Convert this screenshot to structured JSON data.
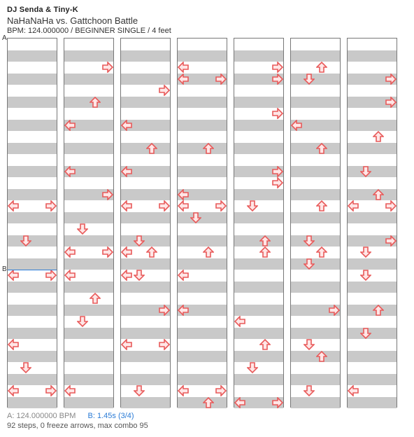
{
  "header": {
    "artist": "DJ Senda & Tiny-K",
    "title": "NaHaNaHa vs. Gattchoon Battle",
    "meta": "BPM: 124.000000 / BEGINNER SINGLE / 4 feet"
  },
  "legend": {
    "a": "A: 124.000000 BPM",
    "b": "B: 1.45s (3/4)"
  },
  "summary": "92 steps, 0 freeze arrows, max combo 95",
  "markers": [
    {
      "label": "A",
      "col": 0,
      "row": 0,
      "blue": false
    },
    {
      "label": "B",
      "col": 0,
      "row": 20,
      "blue": true
    }
  ],
  "chart_data": {
    "type": "table",
    "title": "Step chart — DDR single (4 lanes: L, D, U, R), 7 columns × 32 rows",
    "rows_per_column": 32,
    "lane_width": 18,
    "columns": [
      {
        "arrows": [
          {
            "row": 14,
            "lane": "L"
          },
          {
            "row": 14,
            "lane": "R"
          },
          {
            "row": 17,
            "lane": "D"
          },
          {
            "row": 20,
            "lane": "L"
          },
          {
            "row": 20,
            "lane": "R"
          },
          {
            "row": 26,
            "lane": "L"
          },
          {
            "row": 28,
            "lane": "D"
          },
          {
            "row": 30,
            "lane": "L"
          },
          {
            "row": 30,
            "lane": "R"
          }
        ]
      },
      {
        "arrows": [
          {
            "row": 2,
            "lane": "R"
          },
          {
            "row": 5,
            "lane": "U"
          },
          {
            "row": 7,
            "lane": "L"
          },
          {
            "row": 11,
            "lane": "L"
          },
          {
            "row": 13,
            "lane": "R"
          },
          {
            "row": 16,
            "lane": "D"
          },
          {
            "row": 18,
            "lane": "L"
          },
          {
            "row": 18,
            "lane": "R"
          },
          {
            "row": 20,
            "lane": "L"
          },
          {
            "row": 22,
            "lane": "U"
          },
          {
            "row": 24,
            "lane": "D"
          },
          {
            "row": 30,
            "lane": "L"
          }
        ]
      },
      {
        "arrows": [
          {
            "row": 4,
            "lane": "R"
          },
          {
            "row": 7,
            "lane": "L"
          },
          {
            "row": 9,
            "lane": "U"
          },
          {
            "row": 11,
            "lane": "L"
          },
          {
            "row": 14,
            "lane": "L"
          },
          {
            "row": 14,
            "lane": "R"
          },
          {
            "row": 17,
            "lane": "D"
          },
          {
            "row": 18,
            "lane": "L"
          },
          {
            "row": 18,
            "lane": "U"
          },
          {
            "row": 20,
            "lane": "L"
          },
          {
            "row": 20,
            "lane": "D"
          },
          {
            "row": 23,
            "lane": "R"
          },
          {
            "row": 26,
            "lane": "L"
          },
          {
            "row": 26,
            "lane": "R"
          },
          {
            "row": 30,
            "lane": "D"
          }
        ]
      },
      {
        "arrows": [
          {
            "row": 2,
            "lane": "L"
          },
          {
            "row": 3,
            "lane": "L"
          },
          {
            "row": 3,
            "lane": "R"
          },
          {
            "row": 9,
            "lane": "U"
          },
          {
            "row": 13,
            "lane": "L"
          },
          {
            "row": 14,
            "lane": "L"
          },
          {
            "row": 14,
            "lane": "R"
          },
          {
            "row": 15,
            "lane": "D"
          },
          {
            "row": 18,
            "lane": "U"
          },
          {
            "row": 20,
            "lane": "L"
          },
          {
            "row": 23,
            "lane": "L"
          },
          {
            "row": 30,
            "lane": "L"
          },
          {
            "row": 30,
            "lane": "R"
          },
          {
            "row": 31,
            "lane": "U"
          }
        ]
      },
      {
        "arrows": [
          {
            "row": 2,
            "lane": "R"
          },
          {
            "row": 3,
            "lane": "R"
          },
          {
            "row": 6,
            "lane": "R"
          },
          {
            "row": 11,
            "lane": "R"
          },
          {
            "row": 12,
            "lane": "R"
          },
          {
            "row": 14,
            "lane": "D"
          },
          {
            "row": 17,
            "lane": "U"
          },
          {
            "row": 18,
            "lane": "U"
          },
          {
            "row": 24,
            "lane": "L"
          },
          {
            "row": 26,
            "lane": "U"
          },
          {
            "row": 28,
            "lane": "D"
          },
          {
            "row": 31,
            "lane": "L"
          },
          {
            "row": 31,
            "lane": "R"
          }
        ]
      },
      {
        "arrows": [
          {
            "row": 2,
            "lane": "U"
          },
          {
            "row": 3,
            "lane": "D"
          },
          {
            "row": 7,
            "lane": "L"
          },
          {
            "row": 9,
            "lane": "U"
          },
          {
            "row": 14,
            "lane": "U"
          },
          {
            "row": 17,
            "lane": "D"
          },
          {
            "row": 18,
            "lane": "U"
          },
          {
            "row": 19,
            "lane": "D"
          },
          {
            "row": 23,
            "lane": "R"
          },
          {
            "row": 26,
            "lane": "D"
          },
          {
            "row": 27,
            "lane": "U"
          },
          {
            "row": 30,
            "lane": "D"
          }
        ]
      },
      {
        "arrows": [
          {
            "row": 3,
            "lane": "R"
          },
          {
            "row": 5,
            "lane": "R"
          },
          {
            "row": 8,
            "lane": "U"
          },
          {
            "row": 11,
            "lane": "D"
          },
          {
            "row": 13,
            "lane": "U"
          },
          {
            "row": 14,
            "lane": "L"
          },
          {
            "row": 14,
            "lane": "R"
          },
          {
            "row": 17,
            "lane": "R"
          },
          {
            "row": 18,
            "lane": "D"
          },
          {
            "row": 20,
            "lane": "D"
          },
          {
            "row": 23,
            "lane": "U"
          },
          {
            "row": 25,
            "lane": "D"
          },
          {
            "row": 30,
            "lane": "L"
          }
        ]
      }
    ]
  }
}
